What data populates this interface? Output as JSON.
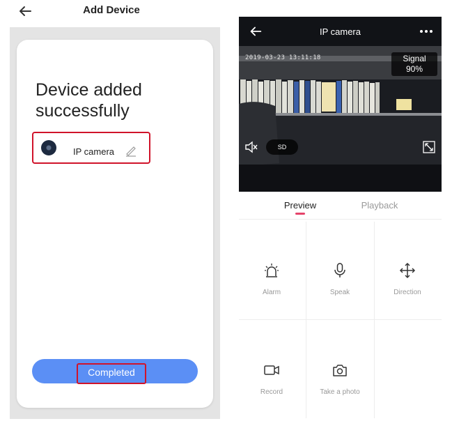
{
  "left_screen": {
    "header": {
      "title": "Add Device",
      "back_icon": "arrow-left-icon"
    },
    "message": "Device added successfully",
    "device": {
      "name": "IP camera",
      "icon": "camera-dot-icon",
      "edit_icon": "pencil-icon"
    },
    "complete_button": {
      "label": "Completed"
    }
  },
  "right_screen": {
    "topbar": {
      "title": "IP camera",
      "back_icon": "arrow-left-icon",
      "more_icon": "more-horizontal-icon"
    },
    "video": {
      "timestamp": "2019-03-23  13:11:18",
      "signal_label": "Signal",
      "signal_value": "90%",
      "sd_label": "SD",
      "mute_icon": "speaker-mute-icon",
      "fullscreen_icon": "fullscreen-icon"
    },
    "tabs": [
      {
        "label": "Preview",
        "active": true
      },
      {
        "label": "Playback",
        "active": false
      }
    ],
    "tools": [
      {
        "label": "Alarm",
        "icon": "alarm-siren-icon"
      },
      {
        "label": "Speak",
        "icon": "microphone-icon"
      },
      {
        "label": "Direction",
        "icon": "move-arrows-icon"
      },
      {
        "label": "Record",
        "icon": "video-record-icon"
      },
      {
        "label": "Take a photo",
        "icon": "camera-icon"
      }
    ]
  },
  "colors": {
    "accent_blue": "#5b8ff5",
    "highlight_red": "#d0132a",
    "tab_indicator": "#e5436a",
    "video_bg": "#181a1f"
  }
}
